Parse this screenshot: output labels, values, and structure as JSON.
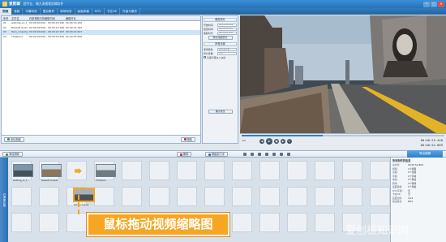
{
  "window": {
    "app_name": "爱剪辑",
    "subtitle": "超专业、随大流视频剪辑软件",
    "controls": [
      "—",
      "□",
      "×"
    ]
  },
  "tabs": [
    "视频",
    "音频",
    "字幕特效",
    "叠加素材",
    "转场特效",
    "画面风格",
    "MTV",
    "卡拉OK",
    "升级与服务"
  ],
  "file_list": {
    "columns": [
      "序号",
      "文件名",
      "在原视频中的截取时间",
      "截取时长"
    ],
    "rows": [
      {
        "no": "01",
        "name": "walking_so_t...",
        "range": "00:00:00.000 - 00:00:16.160",
        "len": "00:00:16.160"
      },
      {
        "no": "02",
        "name": "Bassett Guests",
        "range": "00:00:00.000 - 00:00:14.182",
        "len": "00:00:14.182"
      },
      {
        "no": "03",
        "name": "Twin_crossing",
        "range": "00:00:00.000 - 00:00:22.947",
        "len": "00:00:22.947",
        "selected": true
      },
      {
        "no": "04",
        "name": "TheShore",
        "range": "00:00:00.000 - 00:00:25.440",
        "len": "00:00:25.440"
      }
    ],
    "add_label": "添加视频",
    "delete_label": "删除",
    "split_label": "超级剪刀手"
  },
  "settings": {
    "clip_header": "裁剪原片",
    "start_label": "开始时间:",
    "start_value": "00:00:00.000",
    "end_label": "结束时间:",
    "end_value": "00:00:22.947",
    "length_label": "截取时长:",
    "length_value": "00:00:22.947",
    "preview_btn": "预览/截取原片",
    "sound_header": "声音设置",
    "sound_src_label": "使用音轨:",
    "sound_src_value": "原片原声轨",
    "vol_label": "原片音量:",
    "vol_value": "100",
    "head_tail_label": "头尾声音淡入淡出",
    "apply_btn": "确认修改"
  },
  "player": {
    "current_time": "00:00:25.440",
    "total_time": "00:00:52.869",
    "zoom": "1/4",
    "progress": 0.4
  },
  "storyboard_tools": {
    "label": "已添加片段",
    "export_label": "导出视频"
  },
  "clips": [
    {
      "name": "walking_so_t..."
    },
    {
      "name": "Bassett Guests"
    },
    {
      "name": "TheShore"
    },
    {
      "name": "Twin_crossing"
    }
  ],
  "callout": "鼠标拖动视频缩略图",
  "properties": {
    "header": "所有制作的信息",
    "items": [
      {
        "k": "总时长:",
        "v": "00:00:52.869"
      },
      {
        "k": "视频:",
        "v": "4个视频"
      },
      {
        "k": "音频:",
        "v": "0个音频"
      },
      {
        "k": "字幕:",
        "v": "0个字幕"
      },
      {
        "k": "叠加:",
        "v": "0个叠加"
      },
      {
        "k": "转场:",
        "v": "0个转场"
      },
      {
        "k": "画面风格:",
        "v": "0个风格"
      },
      {
        "k": "MTV字幕:",
        "v": "无"
      },
      {
        "k": "卡拉OK:",
        "v": "无"
      },
      {
        "k": "画面比例:",
        "v": "16:9"
      },
      {
        "k": "输出格式:",
        "v": "MP4"
      }
    ]
  },
  "watermark": "爱创根知识网"
}
